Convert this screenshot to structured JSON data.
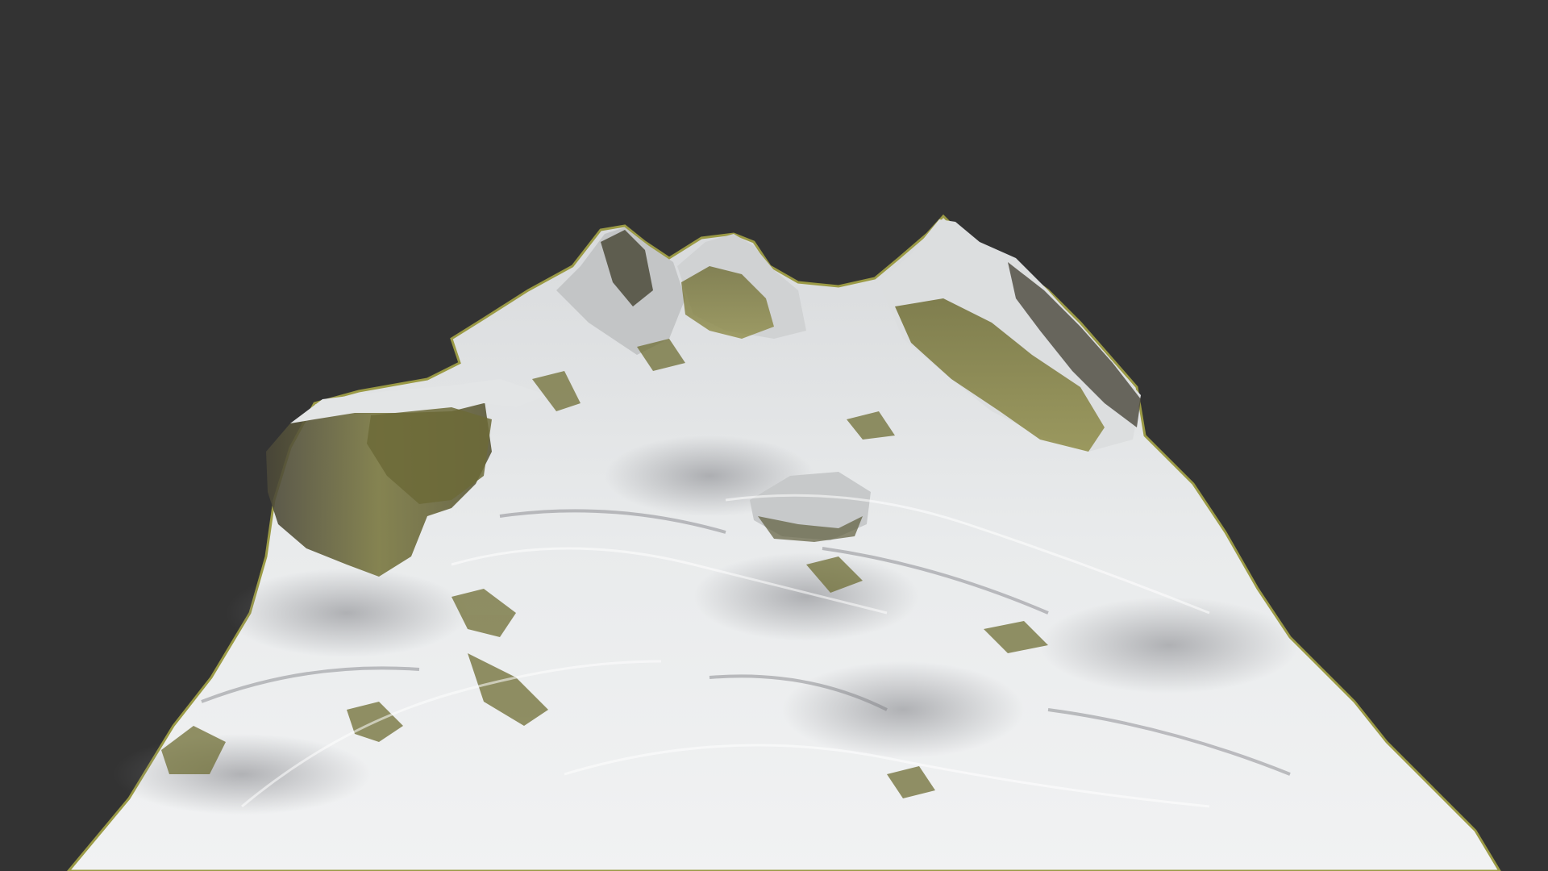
{
  "scene": {
    "subject": "snow-mountain-terrain",
    "colors": {
      "background": "#333333",
      "snow_light": "#eef0f0",
      "snow_mid": "#c9ccce",
      "snow_shadow": "#8e8f93",
      "rock_dark": "#3f3d33",
      "moss": "#7b7a3a",
      "moss_light": "#9a9656",
      "edge": "#a8a64a"
    }
  }
}
